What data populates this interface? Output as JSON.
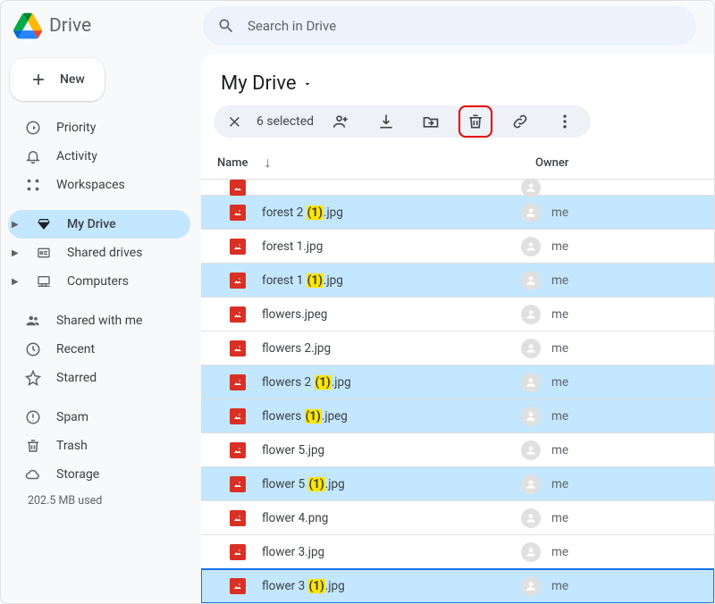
{
  "app": {
    "name": "Drive"
  },
  "search": {
    "placeholder": "Search in Drive"
  },
  "new_button": {
    "label": "New"
  },
  "sidebar": {
    "top": [
      {
        "label": "Priority"
      },
      {
        "label": "Activity"
      },
      {
        "label": "Workspaces"
      }
    ],
    "drives": [
      {
        "label": "My Drive",
        "active": true
      },
      {
        "label": "Shared drives"
      },
      {
        "label": "Computers"
      }
    ],
    "misc": [
      {
        "label": "Shared with me"
      },
      {
        "label": "Recent"
      },
      {
        "label": "Starred"
      }
    ],
    "bottom": [
      {
        "label": "Spam"
      },
      {
        "label": "Trash"
      },
      {
        "label": "Storage"
      }
    ],
    "storage_used": "202.5 MB used"
  },
  "main": {
    "title": "My Drive",
    "selection_count": "6 selected",
    "columns": {
      "name": "Name",
      "owner": "Owner"
    },
    "files": [
      {
        "name": "forest 2 (1).jpg",
        "dup": "(1)",
        "owner": "me",
        "selected": true
      },
      {
        "name": "forest 1.jpg",
        "dup": "",
        "owner": "me",
        "selected": false
      },
      {
        "name": "forest 1 (1).jpg",
        "dup": "(1)",
        "owner": "me",
        "selected": true
      },
      {
        "name": "flowers.jpeg",
        "dup": "",
        "owner": "me",
        "selected": false
      },
      {
        "name": "flowers 2.jpg",
        "dup": "",
        "owner": "me",
        "selected": false
      },
      {
        "name": "flowers 2 (1).jpg",
        "dup": "(1)",
        "owner": "me",
        "selected": true
      },
      {
        "name": "flowers (1).jpeg",
        "dup": "(1)",
        "owner": "me",
        "selected": true
      },
      {
        "name": "flower 5.jpg",
        "dup": "",
        "owner": "me",
        "selected": false
      },
      {
        "name": "flower 5 (1).jpg",
        "dup": "(1)",
        "owner": "me",
        "selected": true
      },
      {
        "name": "flower 4.png",
        "dup": "",
        "owner": "me",
        "selected": false
      },
      {
        "name": "flower 3.jpg",
        "dup": "",
        "owner": "me",
        "selected": false
      },
      {
        "name": "flower 3 (1).jpg",
        "dup": "(1)",
        "owner": "me",
        "selected": true,
        "last": true
      }
    ]
  }
}
